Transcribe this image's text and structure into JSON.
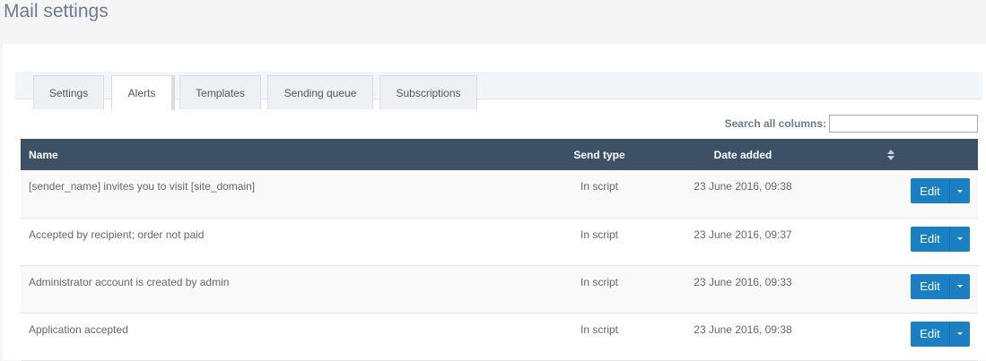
{
  "page": {
    "title": "Mail settings"
  },
  "tabs": [
    {
      "label": "Settings"
    },
    {
      "label": "Alerts",
      "active": true
    },
    {
      "label": "Templates"
    },
    {
      "label": "Sending queue"
    },
    {
      "label": "Subscriptions"
    }
  ],
  "search": {
    "label": "Search all columns:",
    "value": ""
  },
  "table": {
    "columns": {
      "name": "Name",
      "send_type": "Send type",
      "date_added": "Date added"
    },
    "rows": [
      {
        "name": "[sender_name] invites you to visit [site_domain]",
        "send_type": "In script",
        "date_added": "23 June 2016, 09:38",
        "action": "Edit"
      },
      {
        "name": "Accepted by recipient; order not paid",
        "send_type": "In script",
        "date_added": "23 June 2016, 09:37",
        "action": "Edit"
      },
      {
        "name": "Administrator account is created by admin",
        "send_type": "In script",
        "date_added": "23 June 2016, 09:33",
        "action": "Edit"
      },
      {
        "name": "Application accepted",
        "send_type": "In script",
        "date_added": "23 June 2016, 09:38",
        "action": "Edit"
      }
    ]
  },
  "colors": {
    "header_bg": "#3d5166",
    "button_bg": "#1b7fc4",
    "title": "#6b7c93"
  },
  "icons": {
    "sort": "sort-both-icon",
    "dropdown": "caret-down-icon"
  }
}
